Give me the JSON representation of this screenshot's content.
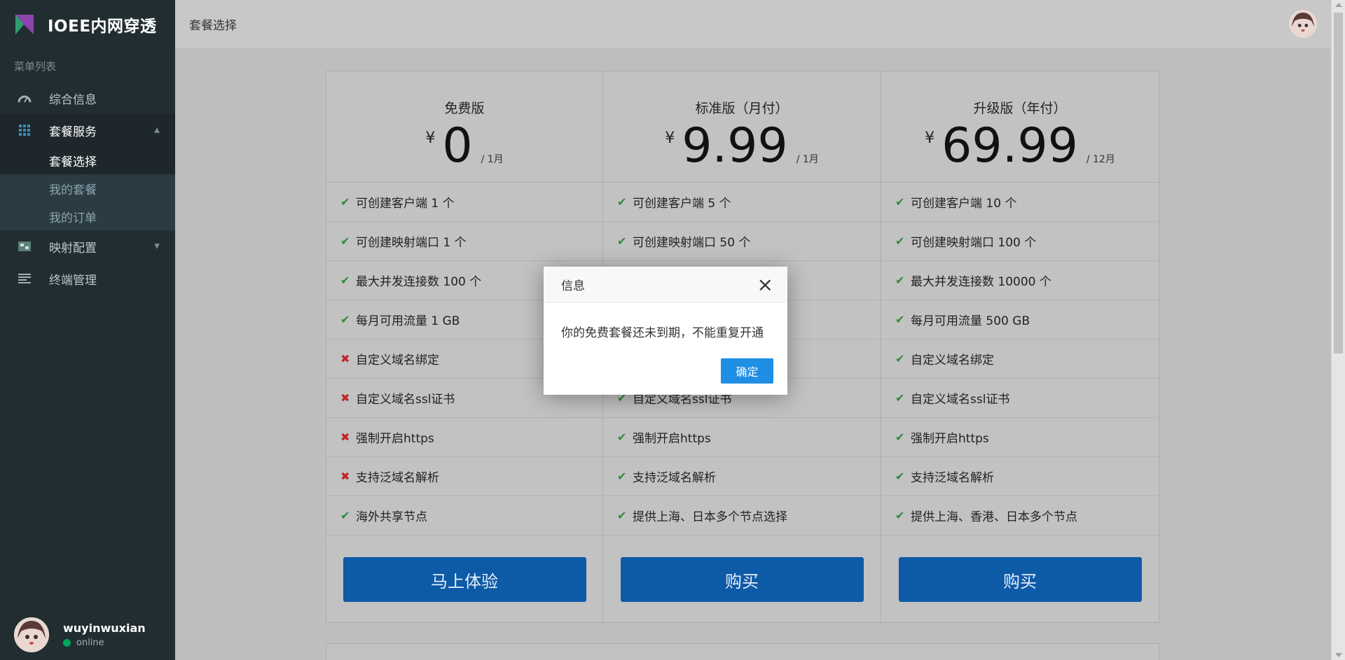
{
  "app": {
    "logo_text": "IOEE内网穿透"
  },
  "sidebar": {
    "menu_header": "菜单列表",
    "items": [
      {
        "label": "综合信息",
        "icon": "dashboard-icon"
      },
      {
        "label": "套餐服务",
        "icon": "grid-icon",
        "expanded": true,
        "children": [
          {
            "label": "套餐选择",
            "active": true
          },
          {
            "label": "我的套餐"
          },
          {
            "label": "我的订单"
          }
        ]
      },
      {
        "label": "映射配置",
        "icon": "mapping-icon"
      },
      {
        "label": "终端管理",
        "icon": "list-icon"
      }
    ]
  },
  "user": {
    "name": "wuyinwuxian",
    "status": "online"
  },
  "header": {
    "title": "套餐选择"
  },
  "currency_symbol": "¥",
  "plans": [
    {
      "name": "免费版",
      "price": "0",
      "period": "/ 1月",
      "features": [
        {
          "text": "可创建客户端 1 个",
          "ok": true
        },
        {
          "text": "可创建映射端口 1 个",
          "ok": true
        },
        {
          "text": "最大并发连接数 100 个",
          "ok": true
        },
        {
          "text": "每月可用流量 1 GB",
          "ok": true
        },
        {
          "text": "自定义域名绑定",
          "ok": false
        },
        {
          "text": "自定义域名ssl证书",
          "ok": false
        },
        {
          "text": "强制开启https",
          "ok": false
        },
        {
          "text": "支持泛域名解析",
          "ok": false
        },
        {
          "text": "海外共享节点",
          "ok": true
        }
      ],
      "button": "马上体验"
    },
    {
      "name": "标准版（月付）",
      "price": "9.99",
      "period": "/ 1月",
      "features": [
        {
          "text": "可创建客户端 5 个",
          "ok": true
        },
        {
          "text": "可创建映射端口 50 个",
          "ok": true
        },
        {
          "text": "",
          "ok": true
        },
        {
          "text": "",
          "ok": true
        },
        {
          "text": "",
          "ok": true
        },
        {
          "text": "自定义域名ssl证书",
          "ok": true
        },
        {
          "text": "强制开启https",
          "ok": true
        },
        {
          "text": "支持泛域名解析",
          "ok": true
        },
        {
          "text": "提供上海、日本多个节点选择",
          "ok": true
        }
      ],
      "button": "购买"
    },
    {
      "name": "升级版（年付）",
      "price": "69.99",
      "period": "/ 12月",
      "features": [
        {
          "text": "可创建客户端 10 个",
          "ok": true
        },
        {
          "text": "可创建映射端口 100 个",
          "ok": true
        },
        {
          "text": "最大并发连接数 10000 个",
          "ok": true
        },
        {
          "text": "每月可用流量 500 GB",
          "ok": true
        },
        {
          "text": "自定义域名绑定",
          "ok": true
        },
        {
          "text": "自定义域名ssl证书",
          "ok": true
        },
        {
          "text": "强制开启https",
          "ok": true
        },
        {
          "text": "支持泛域名解析",
          "ok": true
        },
        {
          "text": "提供上海、香港、日本多个节点",
          "ok": true
        }
      ],
      "button": "购买"
    }
  ],
  "dialog": {
    "title": "信息",
    "message": "你的免费套餐还未到期，不能重复开通",
    "confirm_label": "确定",
    "close_icon": "close-icon"
  },
  "colors": {
    "sidebar_bg": "#222d32",
    "primary_button": "#0d5aa7",
    "dialog_button": "#1e8fe5",
    "check": "#2e8b3a",
    "cross": "#c0262c",
    "online": "#00a65a"
  }
}
